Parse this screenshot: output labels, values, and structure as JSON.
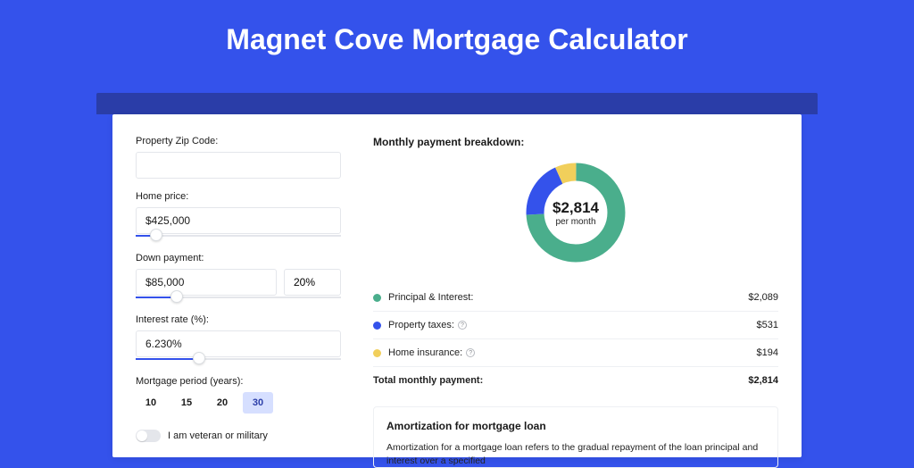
{
  "page_title": "Magnet Cove Mortgage Calculator",
  "form": {
    "zip_label": "Property Zip Code:",
    "zip_value": "",
    "home_price_label": "Home price:",
    "home_price_value": "$425,000",
    "down_payment_label": "Down payment:",
    "down_payment_value": "$85,000",
    "down_payment_pct": "20%",
    "interest_label": "Interest rate (%):",
    "interest_value": "6.230%",
    "period_label": "Mortgage period (years):",
    "periods": [
      "10",
      "15",
      "20",
      "30"
    ],
    "period_selected": "30",
    "veteran_label": "I am veteran or military"
  },
  "breakdown": {
    "title": "Monthly payment breakdown:",
    "center_amount": "$2,814",
    "center_sub": "per month",
    "rows": [
      {
        "color": "green",
        "label": "Principal & Interest:",
        "info": false,
        "value": "$2,089"
      },
      {
        "color": "blue",
        "label": "Property taxes:",
        "info": true,
        "value": "$531"
      },
      {
        "color": "yellow",
        "label": "Home insurance:",
        "info": true,
        "value": "$194"
      }
    ],
    "total_label": "Total monthly payment:",
    "total_value": "$2,814"
  },
  "amortization": {
    "title": "Amortization for mortgage loan",
    "text": "Amortization for a mortgage loan refers to the gradual repayment of the loan principal and interest over a specified"
  },
  "chart_data": {
    "type": "pie",
    "title": "Monthly payment breakdown",
    "categories": [
      "Principal & Interest",
      "Property taxes",
      "Home insurance"
    ],
    "values": [
      2089,
      531,
      194
    ],
    "colors": [
      "#4aae8c",
      "#3452eb",
      "#f1cf5b"
    ],
    "total": 2814,
    "center_label": "$2,814 per month"
  }
}
